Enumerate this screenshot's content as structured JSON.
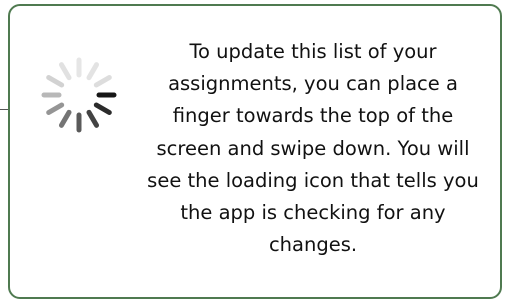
{
  "card": {
    "border_color": "#4f7a50",
    "icon": "loading-spinner-icon",
    "message": "To update this list of your assignments, you can place a finger towards the top of the screen and swipe down. You will see the loading icon that tells you the app is checking for any changes."
  }
}
